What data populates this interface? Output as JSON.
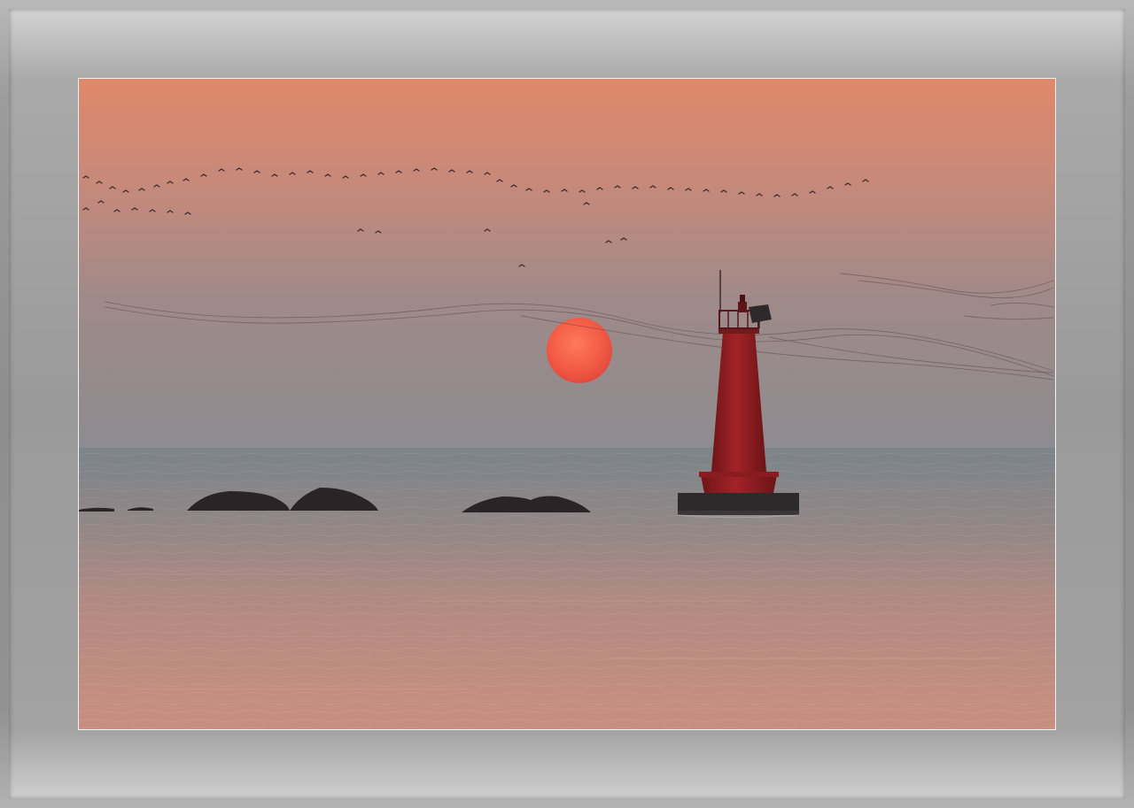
{
  "scene": {
    "subject": "lighthouse",
    "colors": {
      "sky_top": "#e0896c",
      "sky_mid": "#b58a80",
      "sky_horizon": "#8e8c8f",
      "sea_top": "#7e8489",
      "sea_bottom": "#c88e80",
      "sun": "#f25a45",
      "lighthouse": "#9a1f22",
      "rock": "#2b2426",
      "frame": "#9a9a9a"
    }
  }
}
